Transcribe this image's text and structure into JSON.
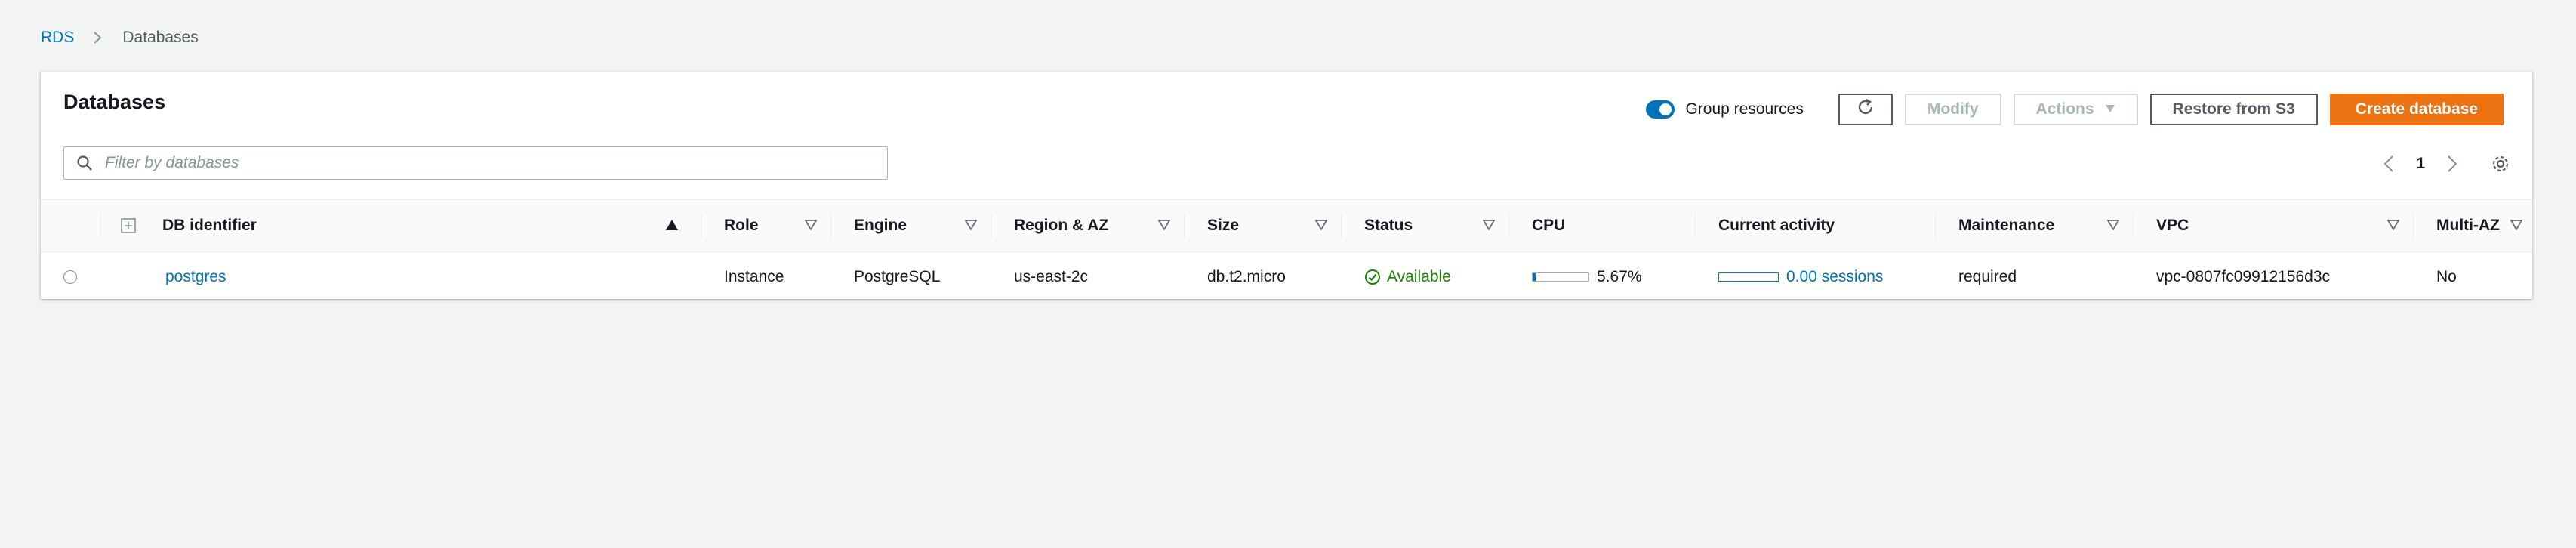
{
  "breadcrumb": {
    "root": "RDS",
    "current": "Databases"
  },
  "panel": {
    "title": "Databases"
  },
  "toolbar": {
    "group_resources_label": "Group resources",
    "group_resources_on": true,
    "refresh_icon": "refresh-icon",
    "modify_label": "Modify",
    "actions_label": "Actions",
    "restore_label": "Restore from S3",
    "create_label": "Create database"
  },
  "filter": {
    "placeholder": "Filter by databases",
    "value": ""
  },
  "pagination": {
    "current_page": "1"
  },
  "table": {
    "headers": {
      "db_identifier": "DB identifier",
      "role": "Role",
      "engine": "Engine",
      "region": "Region & AZ",
      "size": "Size",
      "status": "Status",
      "cpu": "CPU",
      "activity": "Current activity",
      "maintenance": "Maintenance",
      "vpc": "VPC",
      "multiaz": "Multi-AZ"
    },
    "rows": [
      {
        "db_identifier": "postgres",
        "role": "Instance",
        "engine": "PostgreSQL",
        "region": "us-east-2c",
        "size": "db.t2.micro",
        "status": "Available",
        "cpu": "5.67%",
        "cpu_fraction": 0.0567,
        "activity": "0.00 sessions",
        "activity_fraction": 0.0,
        "maintenance": "required",
        "vpc": "vpc-0807fc09912156d3c",
        "multiaz": "No"
      }
    ]
  },
  "colors": {
    "link": "#0073bb",
    "primary": "#ec7211",
    "success": "#1d8102",
    "background": "#f2f3f3"
  }
}
